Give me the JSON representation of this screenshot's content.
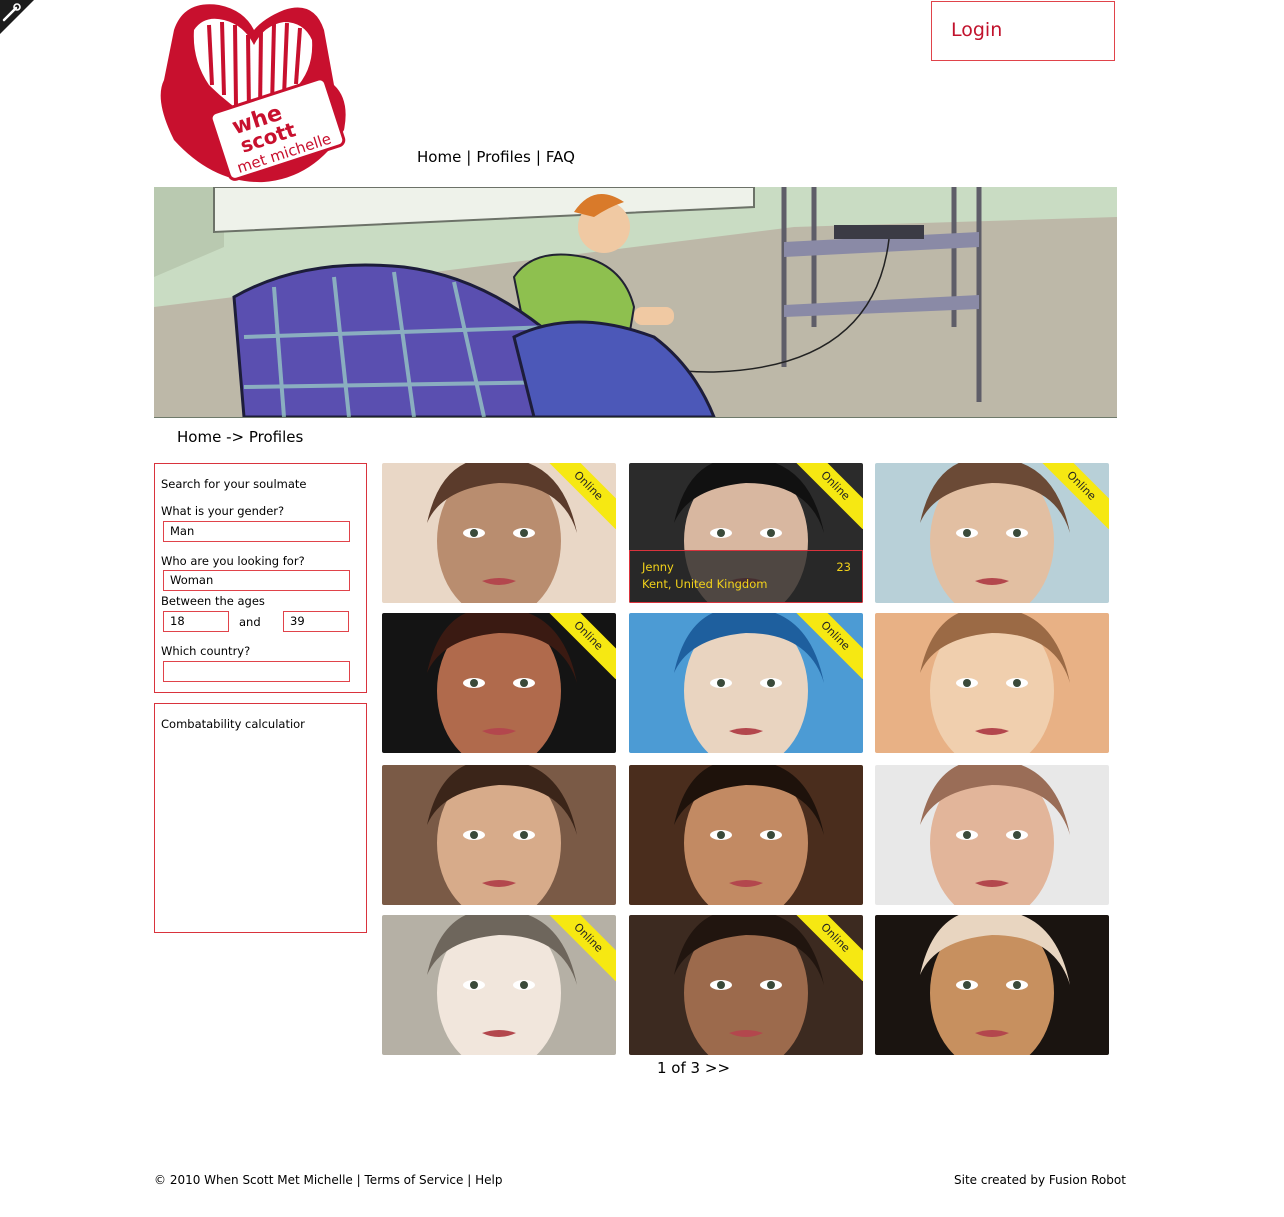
{
  "header": {
    "login_label": "Login",
    "logo_text": {
      "line1": "whe",
      "line2": "scott",
      "line3": "met michelle"
    },
    "nav": [
      {
        "label": "Home"
      },
      {
        "label": "Profiles"
      },
      {
        "label": "FAQ"
      }
    ],
    "nav_separator": "|"
  },
  "breadcrumb": {
    "home": "Home",
    "arrow": "->",
    "current": "Profiles"
  },
  "search": {
    "title": "Search for your soulmate",
    "gender_label": "What is your gender?",
    "gender_value": "Man",
    "looking_label": "Who are you looking for?",
    "looking_value": "Woman",
    "ages_label": "Between the ages",
    "age_min": "18",
    "and_label": "and",
    "age_max": "39",
    "country_label": "Which country?",
    "country_value": ""
  },
  "calculator": {
    "title": "Combatability calculatior"
  },
  "profiles": [
    {
      "online": true
    },
    {
      "online": true,
      "name": "Jenny",
      "age": "23",
      "location": "Kent, United Kingdom"
    },
    {
      "online": true
    },
    {
      "online": true
    },
    {
      "online": true
    },
    {
      "online": false
    },
    {
      "online": false
    },
    {
      "online": false
    },
    {
      "online": false
    },
    {
      "online": true
    },
    {
      "online": true
    },
    {
      "online": false
    }
  ],
  "online_label": "Online",
  "pager": {
    "text": "1 of 3",
    "next": ">>"
  },
  "footer": {
    "copyright": "© 2010 When Scott Met Michelle",
    "separator": "|",
    "terms": "Terms of Service",
    "help": "Help",
    "credit": "Site created by Fusion Robot"
  },
  "colors": {
    "accent": "#c1122c",
    "border": "#d9333d",
    "ribbon": "#f6e812",
    "overlay_text": "#f2d21a"
  }
}
